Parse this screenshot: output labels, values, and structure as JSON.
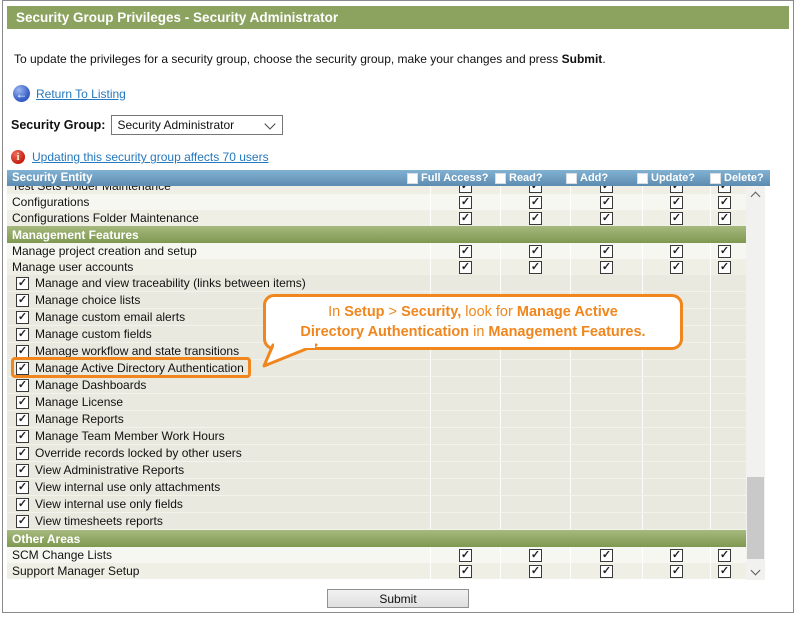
{
  "window": {
    "title": "Security Group Privileges - Security Administrator"
  },
  "intro": {
    "prefix": "To update the privileges for a security group, choose the security group, make your changes and press ",
    "bold": "Submit",
    "suffix": "."
  },
  "nav": {
    "return_link": "Return To Listing"
  },
  "group_selector": {
    "label": "Security Group:",
    "selected": "Security Administrator"
  },
  "notice": {
    "link": "Updating this security group affects 70 users"
  },
  "table": {
    "entity_header": "Security Entity",
    "columns": [
      "Full Access?",
      "Read?",
      "Add?",
      "Update?",
      "Delete?"
    ],
    "header_checkboxes_checked": false,
    "rows": [
      {
        "type": "item",
        "label": "Test Sets Folder Maintenance",
        "checked": true,
        "partial": true
      },
      {
        "type": "item",
        "label": "Configurations",
        "checked": true
      },
      {
        "type": "item",
        "label": "Configurations Folder Maintenance",
        "checked": true
      },
      {
        "type": "section",
        "label": "Management Features"
      },
      {
        "type": "item",
        "label": "Manage project creation and setup",
        "checked": true
      },
      {
        "type": "item",
        "label": "Manage user accounts",
        "checked": true
      },
      {
        "type": "check",
        "label": "Manage and view traceability (links between items)",
        "checked": true
      },
      {
        "type": "check",
        "label": "Manage choice lists",
        "checked": true
      },
      {
        "type": "check",
        "label": "Manage custom email alerts",
        "checked": true
      },
      {
        "type": "check",
        "label": "Manage custom fields",
        "checked": true
      },
      {
        "type": "check",
        "label": "Manage workflow and state transitions",
        "checked": true
      },
      {
        "type": "check",
        "label": "Manage Active Directory Authentication",
        "checked": true,
        "highlight": true
      },
      {
        "type": "check",
        "label": "Manage Dashboards",
        "checked": true
      },
      {
        "type": "check",
        "label": "Manage License",
        "checked": true
      },
      {
        "type": "check",
        "label": "Manage Reports",
        "checked": true
      },
      {
        "type": "check",
        "label": "Manage Team Member Work Hours",
        "checked": true
      },
      {
        "type": "check",
        "label": "Override records locked by other users",
        "checked": true
      },
      {
        "type": "check",
        "label": "View Administrative Reports",
        "checked": true
      },
      {
        "type": "check",
        "label": "View internal use only attachments",
        "checked": true
      },
      {
        "type": "check",
        "label": "View internal use only fields",
        "checked": true
      },
      {
        "type": "check",
        "label": "View timesheets reports",
        "checked": true
      },
      {
        "type": "section",
        "label": "Other Areas"
      },
      {
        "type": "item",
        "label": "SCM Change Lists",
        "checked": true
      },
      {
        "type": "item",
        "label": "Support Manager Setup",
        "checked": true
      }
    ]
  },
  "callout": {
    "l1s0": "In ",
    "l1s1": "Setup",
    "l1s2": " > ",
    "l1s3": "Security,",
    "l1s4": " look for ",
    "l1s5": "Manage Active",
    "l2s0": "Directory Authentication",
    "l2s1": " in ",
    "l2s2": "Management Features."
  },
  "submit": {
    "label": "Submit"
  },
  "icons": {
    "return_icon": "left-arrow-circle",
    "return_glyph": "←",
    "info_icon": "red-info-circle",
    "info_glyph": "i",
    "check_glyph": "✓",
    "dropdown_chevron": "chevron-down",
    "scroll_up": "chevron-up",
    "scroll_down": "chevron-down"
  },
  "colors": {
    "title_green": "#8CA25F",
    "section_green_top": "#A6B97E",
    "section_green_bottom": "#7E9850",
    "header_blue_top": "#82B2D2",
    "header_blue_bottom": "#5C8BB1",
    "link_blue": "#2578BE",
    "callout_orange": "#F0861D"
  }
}
